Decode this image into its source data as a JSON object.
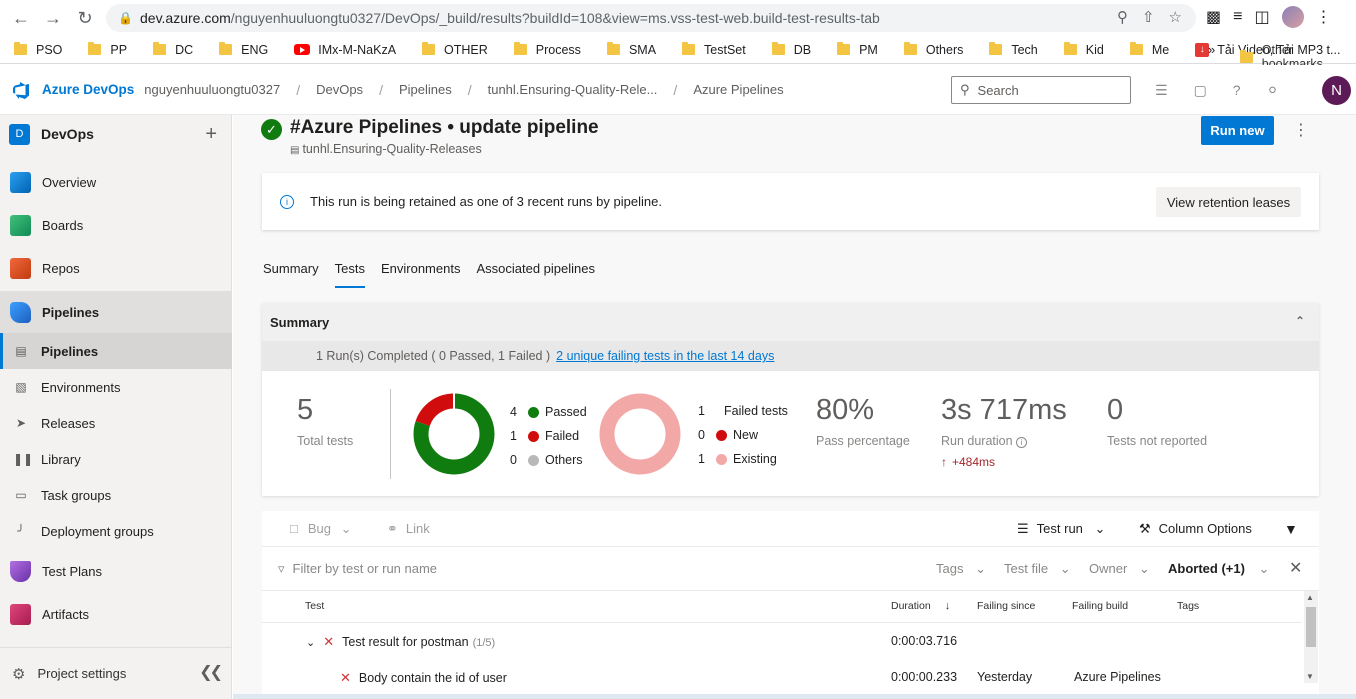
{
  "browser": {
    "url_host": "dev.azure.com",
    "url_path": "/nguyenhuuluongtu0327/DevOps/_build/results?buildId=108&view=ms.vss-test-web.build-test-results-tab",
    "bookmarks": [
      "PSO",
      "PP",
      "DC",
      "ENG",
      "IMx-M-NaKzA",
      "OTHER",
      "Process",
      "SMA",
      "TestSet",
      "DB",
      "PM",
      "Others",
      "Tech",
      "Kid",
      "Me",
      "Tải Video, Tải MP3 t..."
    ],
    "more": "»",
    "other_bookmarks": "Other bookmarks"
  },
  "ado": {
    "brand": "Azure DevOps",
    "org": "nguyenhuuluongtu0327",
    "breadcrumbs": [
      "DevOps",
      "Pipelines",
      "tunhl.Ensuring-Quality-Rele...",
      "Azure Pipelines"
    ],
    "search_placeholder": "Search",
    "avatar_initial": "N"
  },
  "sidebar": {
    "project_initial": "D",
    "project_name": "DevOps",
    "items": [
      "Overview",
      "Boards",
      "Repos",
      "Pipelines"
    ],
    "pipeline_subitems": [
      "Pipelines",
      "Environments",
      "Releases",
      "Library",
      "Task groups",
      "Deployment groups"
    ],
    "items_after": [
      "Test Plans",
      "Artifacts"
    ],
    "project_settings": "Project settings"
  },
  "run": {
    "title": "#Azure Pipelines • update pipeline",
    "subtitle": "tunhl.Ensuring-Quality-Releases",
    "run_new": "Run new"
  },
  "retention": {
    "message": "This run is being retained as one of 3 recent runs by pipeline.",
    "button": "View retention leases"
  },
  "tabs": [
    "Summary",
    "Tests",
    "Environments",
    "Associated pipelines"
  ],
  "summary": {
    "header": "Summary",
    "run_line": "1 Run(s) Completed ( 0 Passed, 1 Failed )",
    "run_link": "2 unique failing tests in the last 14 days",
    "total_tests": "5",
    "total_tests_label": "Total tests",
    "outcome_legend": [
      {
        "count": "4",
        "label": "Passed",
        "color": "#107c10"
      },
      {
        "count": "1",
        "label": "Failed",
        "color": "#d10c0c"
      },
      {
        "count": "0",
        "label": "Others",
        "color": "#b8b8b8"
      }
    ],
    "failed_legend": [
      {
        "count": "1",
        "label": "Failed tests",
        "color": ""
      },
      {
        "count": "0",
        "label": "New",
        "color": "#d10c0c"
      },
      {
        "count": "1",
        "label": "Existing",
        "color": "#f3a8a8"
      }
    ],
    "pass_pct": "80%",
    "pass_pct_label": "Pass percentage",
    "duration": "3s 717ms",
    "duration_label": "Run duration",
    "duration_delta": "+484ms",
    "not_reported": "0",
    "not_reported_label": "Tests not reported"
  },
  "toolbar": {
    "bug": "Bug",
    "link": "Link",
    "test_run": "Test run",
    "column_options": "Column Options"
  },
  "filters": {
    "placeholder": "Filter by test or run name",
    "tags": "Tags",
    "test_file": "Test file",
    "owner": "Owner",
    "outcome": "Aborted (+1)"
  },
  "table": {
    "headers": [
      "Test",
      "Duration",
      "Failing since",
      "Failing build",
      "Tags"
    ],
    "rows": [
      {
        "name": "Test result for postman",
        "count": "(1/5)",
        "duration": "0:00:03.716",
        "failing_since": "",
        "failing_build": ""
      },
      {
        "name": "Body contain the id of user",
        "count": "",
        "duration": "0:00:00.233",
        "failing_since": "Yesterday",
        "failing_build": "Azure Pipelines"
      }
    ]
  }
}
